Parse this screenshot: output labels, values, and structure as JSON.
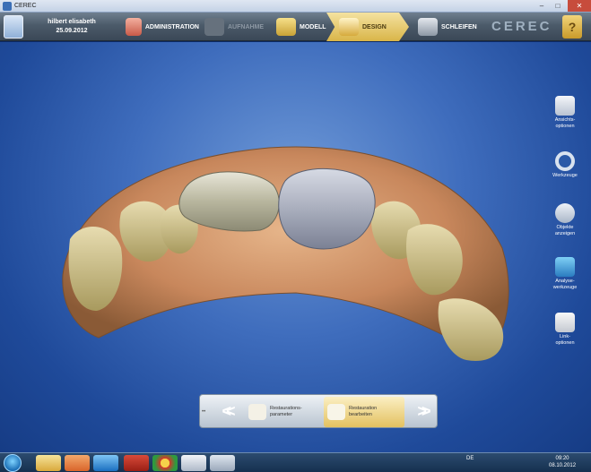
{
  "window": {
    "title": "CEREC"
  },
  "patient": {
    "name": "hilbert elisabeth",
    "date": "25.09.2012"
  },
  "workflow": {
    "steps": [
      {
        "label": "ADMINISTRATION",
        "state": "normal"
      },
      {
        "label": "AUFNAHME",
        "state": "disabled"
      },
      {
        "label": "MODELL",
        "state": "normal"
      },
      {
        "label": "DESIGN",
        "state": "active"
      },
      {
        "label": "SCHLEIFEN",
        "state": "normal"
      }
    ]
  },
  "brand": {
    "text": "CEREC"
  },
  "tools": [
    {
      "label": "Ansichts-\noptionen",
      "icon": "view-options-icon"
    },
    {
      "label": "Werkzeuge",
      "icon": "tools-ring-icon"
    },
    {
      "label": "Objekte\nanzeigen",
      "icon": "show-objects-icon"
    },
    {
      "label": "Analyse-\nwerkzeuge",
      "icon": "analysis-tools-icon"
    },
    {
      "label": "Link-\noptionen",
      "icon": "link-options-icon"
    }
  ],
  "phasebar": {
    "items": [
      {
        "label": "Restaurations-\nparameter",
        "active": false
      },
      {
        "label": "Restauration\nbearbeiten",
        "active": true
      }
    ]
  },
  "taskbar": {
    "language": "DE",
    "time": "09:20",
    "date": "08.10.2012"
  },
  "colors": {
    "active_step": "#d9b548",
    "canvas_bg": "#3f6dbd",
    "header_bg": "#4c5b6a"
  }
}
